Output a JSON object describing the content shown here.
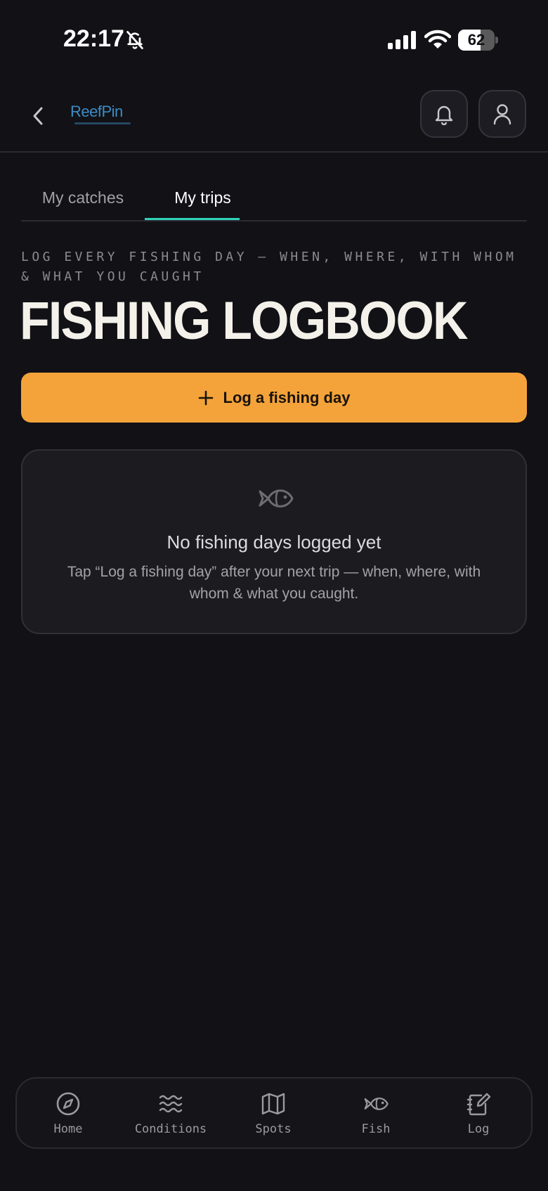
{
  "status_bar": {
    "time": "22:17",
    "battery_level": "62",
    "battery_fraction": 0.62
  },
  "header": {
    "logo_text": "ReefPin",
    "back_icon": "chevron-left-icon",
    "notification_icon": "bell-icon",
    "profile_icon": "user-icon"
  },
  "tabs": [
    {
      "label": "My catches",
      "active": false
    },
    {
      "label": "My trips",
      "active": true
    }
  ],
  "tab_accent": "#2fd3b8",
  "main": {
    "subtitle": "LOG EVERY FISHING DAY — WHEN, WHERE, WITH WHOM & WHAT YOU CAUGHT",
    "title": "FISHING LOGBOOK",
    "log_button_label": "Log a fishing day",
    "log_button_color": "#f4a33b"
  },
  "empty_state": {
    "icon": "fish-icon",
    "title": "No fishing days logged yet",
    "description": "Tap “Log a fishing day” after your next trip — when, where, with whom & what you caught."
  },
  "bottom_nav": {
    "items": [
      {
        "label": "Home",
        "icon": "compass-icon"
      },
      {
        "label": "Conditions",
        "icon": "waves-icon"
      },
      {
        "label": "Spots",
        "icon": "map-icon"
      },
      {
        "label": "Fish",
        "icon": "fish-icon"
      },
      {
        "label": "Log",
        "icon": "notebook-icon"
      }
    ]
  }
}
